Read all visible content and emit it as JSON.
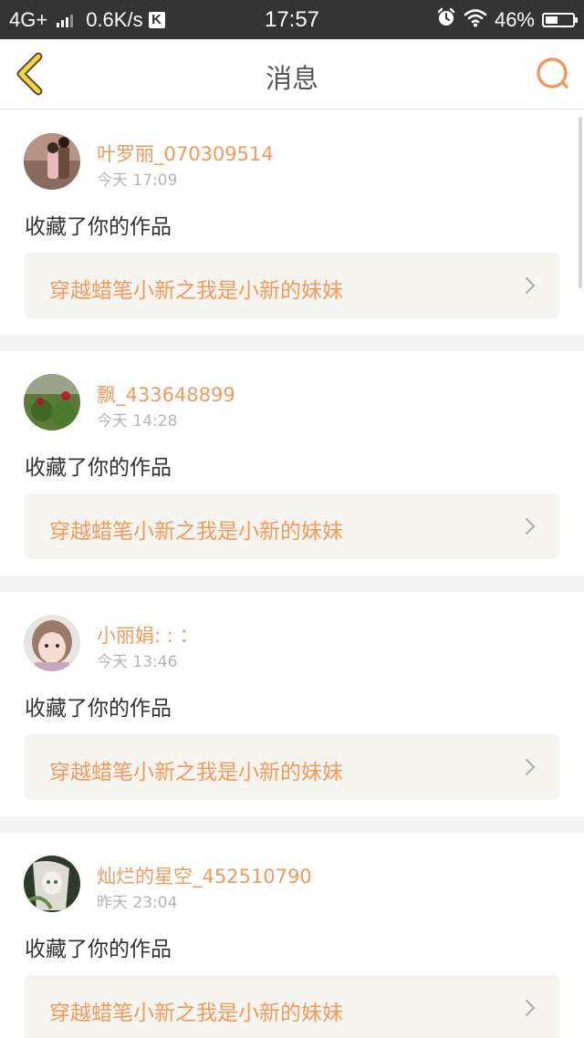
{
  "status_bar": {
    "network": "4G+",
    "speed": "0.6K/s",
    "k_label": "K",
    "time": "17:57",
    "battery": "46%",
    "battery_level": 0.46
  },
  "header": {
    "title": "消息",
    "back_icon": "chevron-left-icon",
    "search_icon": "search-icon",
    "accent_color": "#ef9a5e"
  },
  "messages": [
    {
      "username": "叶罗丽_070309514",
      "time": "今天 17:09",
      "action": "收藏了你的作品",
      "work_title": "穿越蜡笔小新之我是小新的妹妹"
    },
    {
      "username": "飘_433648899",
      "time": "今天 14:28",
      "action": "收藏了你的作品",
      "work_title": "穿越蜡笔小新之我是小新的妹妹"
    },
    {
      "username": "小丽娟: : ：",
      "time": "今天 13:46",
      "action": "收藏了你的作品",
      "work_title": "穿越蜡笔小新之我是小新的妹妹"
    },
    {
      "username": "灿烂的星空_452510790",
      "time": "昨天 23:04",
      "action": "收藏了你的作品",
      "work_title": "穿越蜡笔小新之我是小新的妹妹"
    }
  ]
}
